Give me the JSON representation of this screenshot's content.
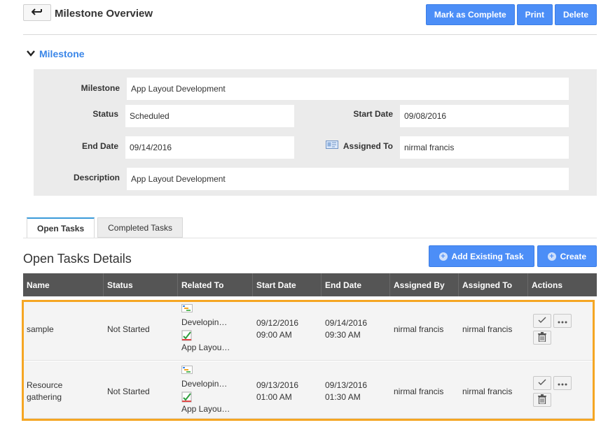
{
  "header": {
    "title": "Milestone Overview",
    "actions": [
      "Mark as Complete",
      "Print",
      "Delete"
    ]
  },
  "milestone_section": {
    "label": "Milestone",
    "fields": {
      "milestone": {
        "label": "Milestone",
        "value": "App Layout Development"
      },
      "status": {
        "label": "Status",
        "value": "Scheduled"
      },
      "start_date": {
        "label": "Start Date",
        "value": "09/08/2016"
      },
      "end_date": {
        "label": "End Date",
        "value": "09/14/2016"
      },
      "assigned_to": {
        "label": "Assigned To",
        "value": "nirmal francis"
      },
      "description": {
        "label": "Description",
        "value": "App Layout Development"
      }
    }
  },
  "tabs": [
    "Open Tasks",
    "Completed Tasks"
  ],
  "details": {
    "title": "Open Tasks Details",
    "actions": [
      "Add Existing Task",
      "Create"
    ]
  },
  "table": {
    "columns": [
      "Name",
      "Status",
      "Related To",
      "Start Date",
      "End Date",
      "Assigned By",
      "Assigned To",
      "Actions"
    ],
    "rows": [
      {
        "name": "sample",
        "status": "Not Started",
        "related_1": "Developin…",
        "related_2": "App Layou…",
        "start_date": "09/12/2016",
        "start_time": "09:00 AM",
        "end_date": "09/14/2016",
        "end_time": "09:30 AM",
        "assigned_by": "nirmal francis",
        "assigned_to": "nirmal francis"
      },
      {
        "name_line1": "Resource",
        "name_line2": "gathering",
        "status": "Not Started",
        "related_1": "Developin…",
        "related_2": "App Layou…",
        "start_date": "09/13/2016",
        "start_time": "01:00 AM",
        "end_date": "09/13/2016",
        "end_time": "01:30 AM",
        "assigned_by": "nirmal francis",
        "assigned_to": "nirmal francis"
      }
    ]
  },
  "colors": {
    "accent": "#4c8ef7",
    "section_label": "#3a86e8",
    "highlight_border": "#f5a623",
    "table_header": "#555555"
  }
}
